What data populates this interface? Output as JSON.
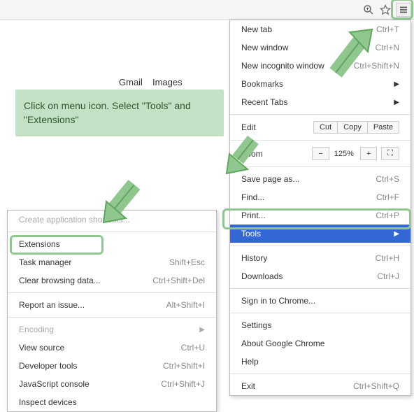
{
  "toolbar": {
    "zoom_icon": "zoom",
    "star_icon": "star",
    "menu_icon": "hamburger"
  },
  "links": {
    "gmail": "Gmail",
    "images": "Images"
  },
  "hint": {
    "text": "Click on menu icon. Select \"Tools\" and \"Extensions\""
  },
  "main_menu": {
    "sections": [
      [
        {
          "label": "New tab",
          "shortcut": "Ctrl+T",
          "interactable": true
        },
        {
          "label": "New window",
          "shortcut": "Ctrl+N",
          "interactable": true
        },
        {
          "label": "New incognito window",
          "shortcut": "Ctrl+Shift+N",
          "interactable": true
        },
        {
          "label": "Bookmarks",
          "submenu": true,
          "interactable": true
        },
        {
          "label": "Recent Tabs",
          "submenu": true,
          "interactable": true
        }
      ],
      "edit_row",
      "zoom_row",
      [
        {
          "label": "Save page as...",
          "shortcut": "Ctrl+S",
          "interactable": true
        },
        {
          "label": "Find...",
          "shortcut": "Ctrl+F",
          "interactable": true
        },
        {
          "label": "Print...",
          "shortcut": "Ctrl+P",
          "interactable": true
        },
        {
          "label": "Tools",
          "submenu": true,
          "selected": true,
          "interactable": true
        }
      ],
      [
        {
          "label": "History",
          "shortcut": "Ctrl+H",
          "interactable": true
        },
        {
          "label": "Downloads",
          "shortcut": "Ctrl+J",
          "interactable": true
        }
      ],
      [
        {
          "label": "Sign in to Chrome...",
          "interactable": true
        }
      ],
      [
        {
          "label": "Settings",
          "interactable": true
        },
        {
          "label": "About Google Chrome",
          "interactable": true
        },
        {
          "label": "Help",
          "interactable": true
        }
      ],
      [
        {
          "label": "Exit",
          "shortcut": "Ctrl+Shift+Q",
          "interactable": true
        }
      ]
    ],
    "edit": {
      "label": "Edit",
      "cut": "Cut",
      "copy": "Copy",
      "paste": "Paste"
    },
    "zoom": {
      "label": "Zoom",
      "minus": "−",
      "value": "125%",
      "plus": "+",
      "fullscreen": "⛶"
    }
  },
  "sub_menu": {
    "sections": [
      [
        {
          "label": "Create application shortcuts...",
          "disabled": true,
          "interactable": false
        }
      ],
      [
        {
          "label": "Extensions",
          "highlight": true,
          "interactable": true
        },
        {
          "label": "Task manager",
          "shortcut": "Shift+Esc",
          "interactable": true
        },
        {
          "label": "Clear browsing data...",
          "shortcut": "Ctrl+Shift+Del",
          "interactable": true
        }
      ],
      [
        {
          "label": "Report an issue...",
          "shortcut": "Alt+Shift+I",
          "interactable": true
        }
      ],
      [
        {
          "label": "Encoding",
          "submenu": true,
          "disabled": true,
          "interactable": false
        },
        {
          "label": "View source",
          "shortcut": "Ctrl+U",
          "interactable": true
        },
        {
          "label": "Developer tools",
          "shortcut": "Ctrl+Shift+I",
          "interactable": true
        },
        {
          "label": "JavaScript console",
          "shortcut": "Ctrl+Shift+J",
          "interactable": true
        },
        {
          "label": "Inspect devices",
          "interactable": true
        }
      ]
    ]
  }
}
